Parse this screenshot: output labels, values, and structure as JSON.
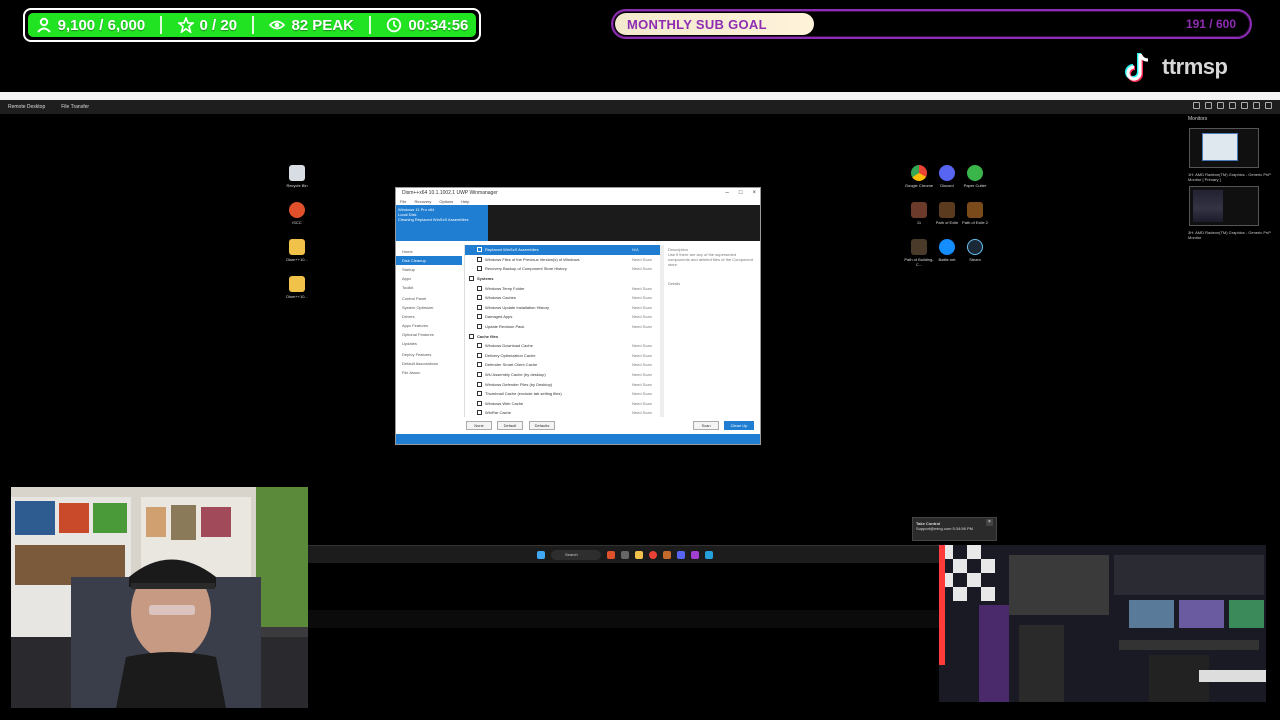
{
  "overlay": {
    "stats": {
      "followers": "9,100 / 6,000",
      "stars": "0 / 20",
      "viewers": "82 PEAK",
      "uptime": "00:34:56"
    },
    "sub_goal": {
      "label": "MONTHLY SUB GOAL",
      "count": "191 / 600",
      "progress": 0.318
    },
    "tiktok_handle": "ttrmsp",
    "colors": {
      "stats_green": "#22e322",
      "goal_purple": "#8e2db3",
      "windows_blue": "#1f7ed2"
    }
  },
  "remote_desktop": {
    "tabs": [
      "Remote Desktop",
      "File Transfer"
    ],
    "monitors_panel": {
      "title": "Monitors",
      "items": [
        "1H: AMD Radeon(TM) Graphics - Generic PnP Monitor [ Primary ]",
        "3H: AMD Radeon(TM) Graphics - Generic PnP Monitor"
      ]
    },
    "desktop_icons_left": [
      "Recycle Bin",
      "iSCC",
      "Dism++10...",
      "Dism++10..."
    ],
    "desktop_icons_right": [
      "Google Chrome",
      "Discord",
      "Paper Cutter",
      "11",
      "Path of Exile",
      "Path of Exile 2",
      "Path of Building-C...",
      "Battle.net",
      "Steam"
    ]
  },
  "app_window": {
    "title": "Dism++x64 10.1.1002.1 UWP Winmanager",
    "menu": [
      "File",
      "Recovery",
      "Options",
      "Help"
    ],
    "header_info": [
      "Windows 11 Pro x64",
      "Local Disk",
      "Cleaning Replaced WinSxS Assemblies"
    ],
    "nav": [
      "Home",
      "Disk Cleanup",
      "Startup",
      "Appx",
      "Toolkit",
      "Control Panel",
      "System Optimizer",
      "Drivers",
      "Appx Features",
      "Optional Features",
      "Updates",
      "Deploy Features",
      "Default Associations",
      "File Assoc"
    ],
    "nav_active_index": 1,
    "rows": [
      {
        "type": "item",
        "name": "Replaced WinSxS Assemblies",
        "status": "N/A",
        "selected": true
      },
      {
        "type": "item",
        "name": "Windows Files of the Previous Version(s) of Windows",
        "status": "Need Scan"
      },
      {
        "type": "item",
        "name": "Recovery Backup of Component Store History",
        "status": "Need Scan"
      },
      {
        "type": "group",
        "name": "Systems"
      },
      {
        "type": "item",
        "name": "Windows Temp Folder",
        "status": "Need Scan"
      },
      {
        "type": "item",
        "name": "Windows Caches",
        "status": "Need Scan"
      },
      {
        "type": "item",
        "name": "Windows Update Installation History",
        "status": "Need Scan"
      },
      {
        "type": "item",
        "name": "Damaged Apps",
        "status": "Need Scan"
      },
      {
        "type": "item",
        "name": "Update Revision Pack",
        "status": "Need Scan"
      },
      {
        "type": "group",
        "name": "Cache files"
      },
      {
        "type": "item",
        "name": "Windows Download Cache",
        "status": "Need Scan"
      },
      {
        "type": "item",
        "name": "Delivery Optimization Cache",
        "status": "Need Scan"
      },
      {
        "type": "item",
        "name": "Defender Smart Client Cache",
        "status": "Need Scan"
      },
      {
        "type": "item",
        "name": "WU Assembly Cache (by desktop)",
        "status": "Need Scan"
      },
      {
        "type": "item",
        "name": "Windows Defender Files (by Desktop)",
        "status": "Need Scan"
      },
      {
        "type": "item",
        "name": "Thumbnail Cache (exclude tab setting files)",
        "status": "Need Scan"
      },
      {
        "type": "item",
        "name": "Windows Web Cache",
        "status": "Need Scan"
      },
      {
        "type": "item",
        "name": "WinRar Cache",
        "status": "Need Scan"
      }
    ],
    "description_title": "Description",
    "description_text": "Use if there are any of the superseded components and deleted files of the Component store.",
    "details_label": "Details",
    "buttons": {
      "none": "None",
      "default": "Default",
      "defaults": "Defaults",
      "scan": "Scan",
      "clean_up": "Clean Up"
    }
  },
  "taskbar": {
    "search_placeholder": "Search"
  },
  "notification": {
    "title": "Take Control",
    "text": "Support@ming.com 5:34:56 PM"
  }
}
